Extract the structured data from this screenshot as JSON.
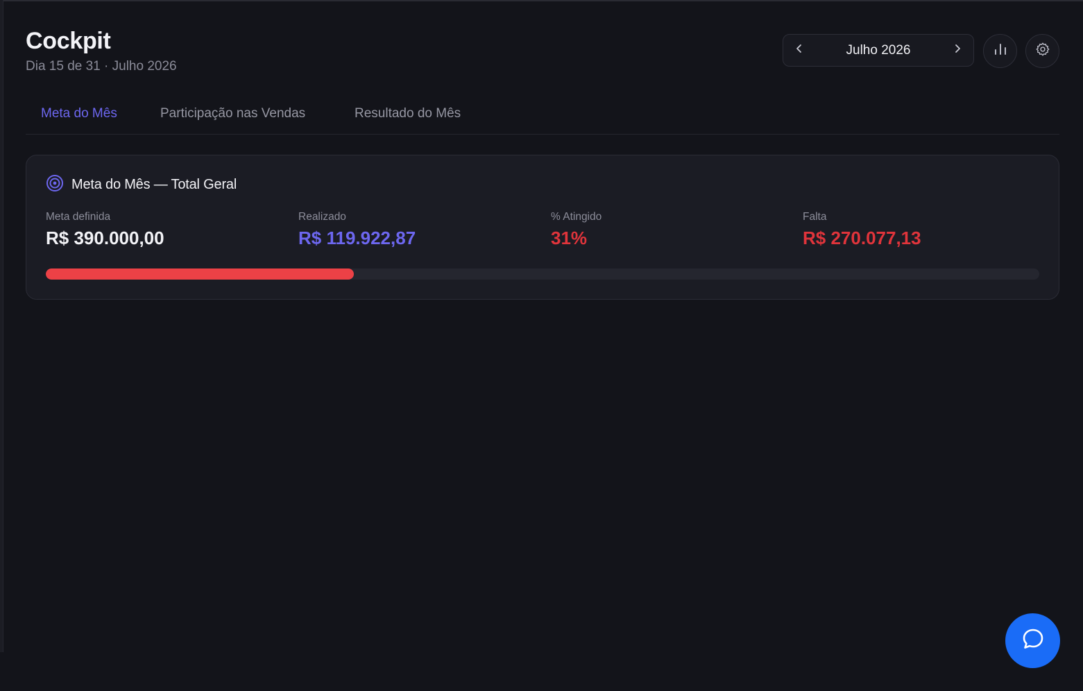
{
  "header": {
    "title": "Cockpit",
    "subtitle": "Dia 15 de 31 · Julho 2026",
    "month_selector": {
      "label": "Julho 2026",
      "prev_icon": "chevron-left-icon",
      "next_icon": "chevron-right-icon"
    },
    "actions": [
      {
        "icon": "bar-chart-icon"
      },
      {
        "icon": "gear-icon"
      }
    ]
  },
  "tabs": [
    {
      "label": "Meta do Mês",
      "active": true
    },
    {
      "label": "Participação nas Vendas",
      "active": false
    },
    {
      "label": "Resultado do Mês",
      "active": false
    }
  ],
  "goal_card": {
    "icon": "target-icon",
    "title": "Meta do Mês — Total Geral",
    "stats": [
      {
        "label": "Meta definida",
        "value": "R$ 390.000,00"
      },
      {
        "label": "Realizado",
        "value": "R$ 119.922,87"
      },
      {
        "label": "% Atingido",
        "value": "31%"
      },
      {
        "label": "Falta",
        "value": "R$ 270.077,13"
      }
    ],
    "progress_fraction": 0.31
  },
  "chat": {
    "icon": "chat-bubble-icon"
  },
  "colors": {
    "background": "#13141a",
    "card": "#1b1c24",
    "accent": "#6d67f0",
    "danger": "#e0343b",
    "progress_fill": "#ec4146",
    "chat_button": "#1a6cf7"
  }
}
